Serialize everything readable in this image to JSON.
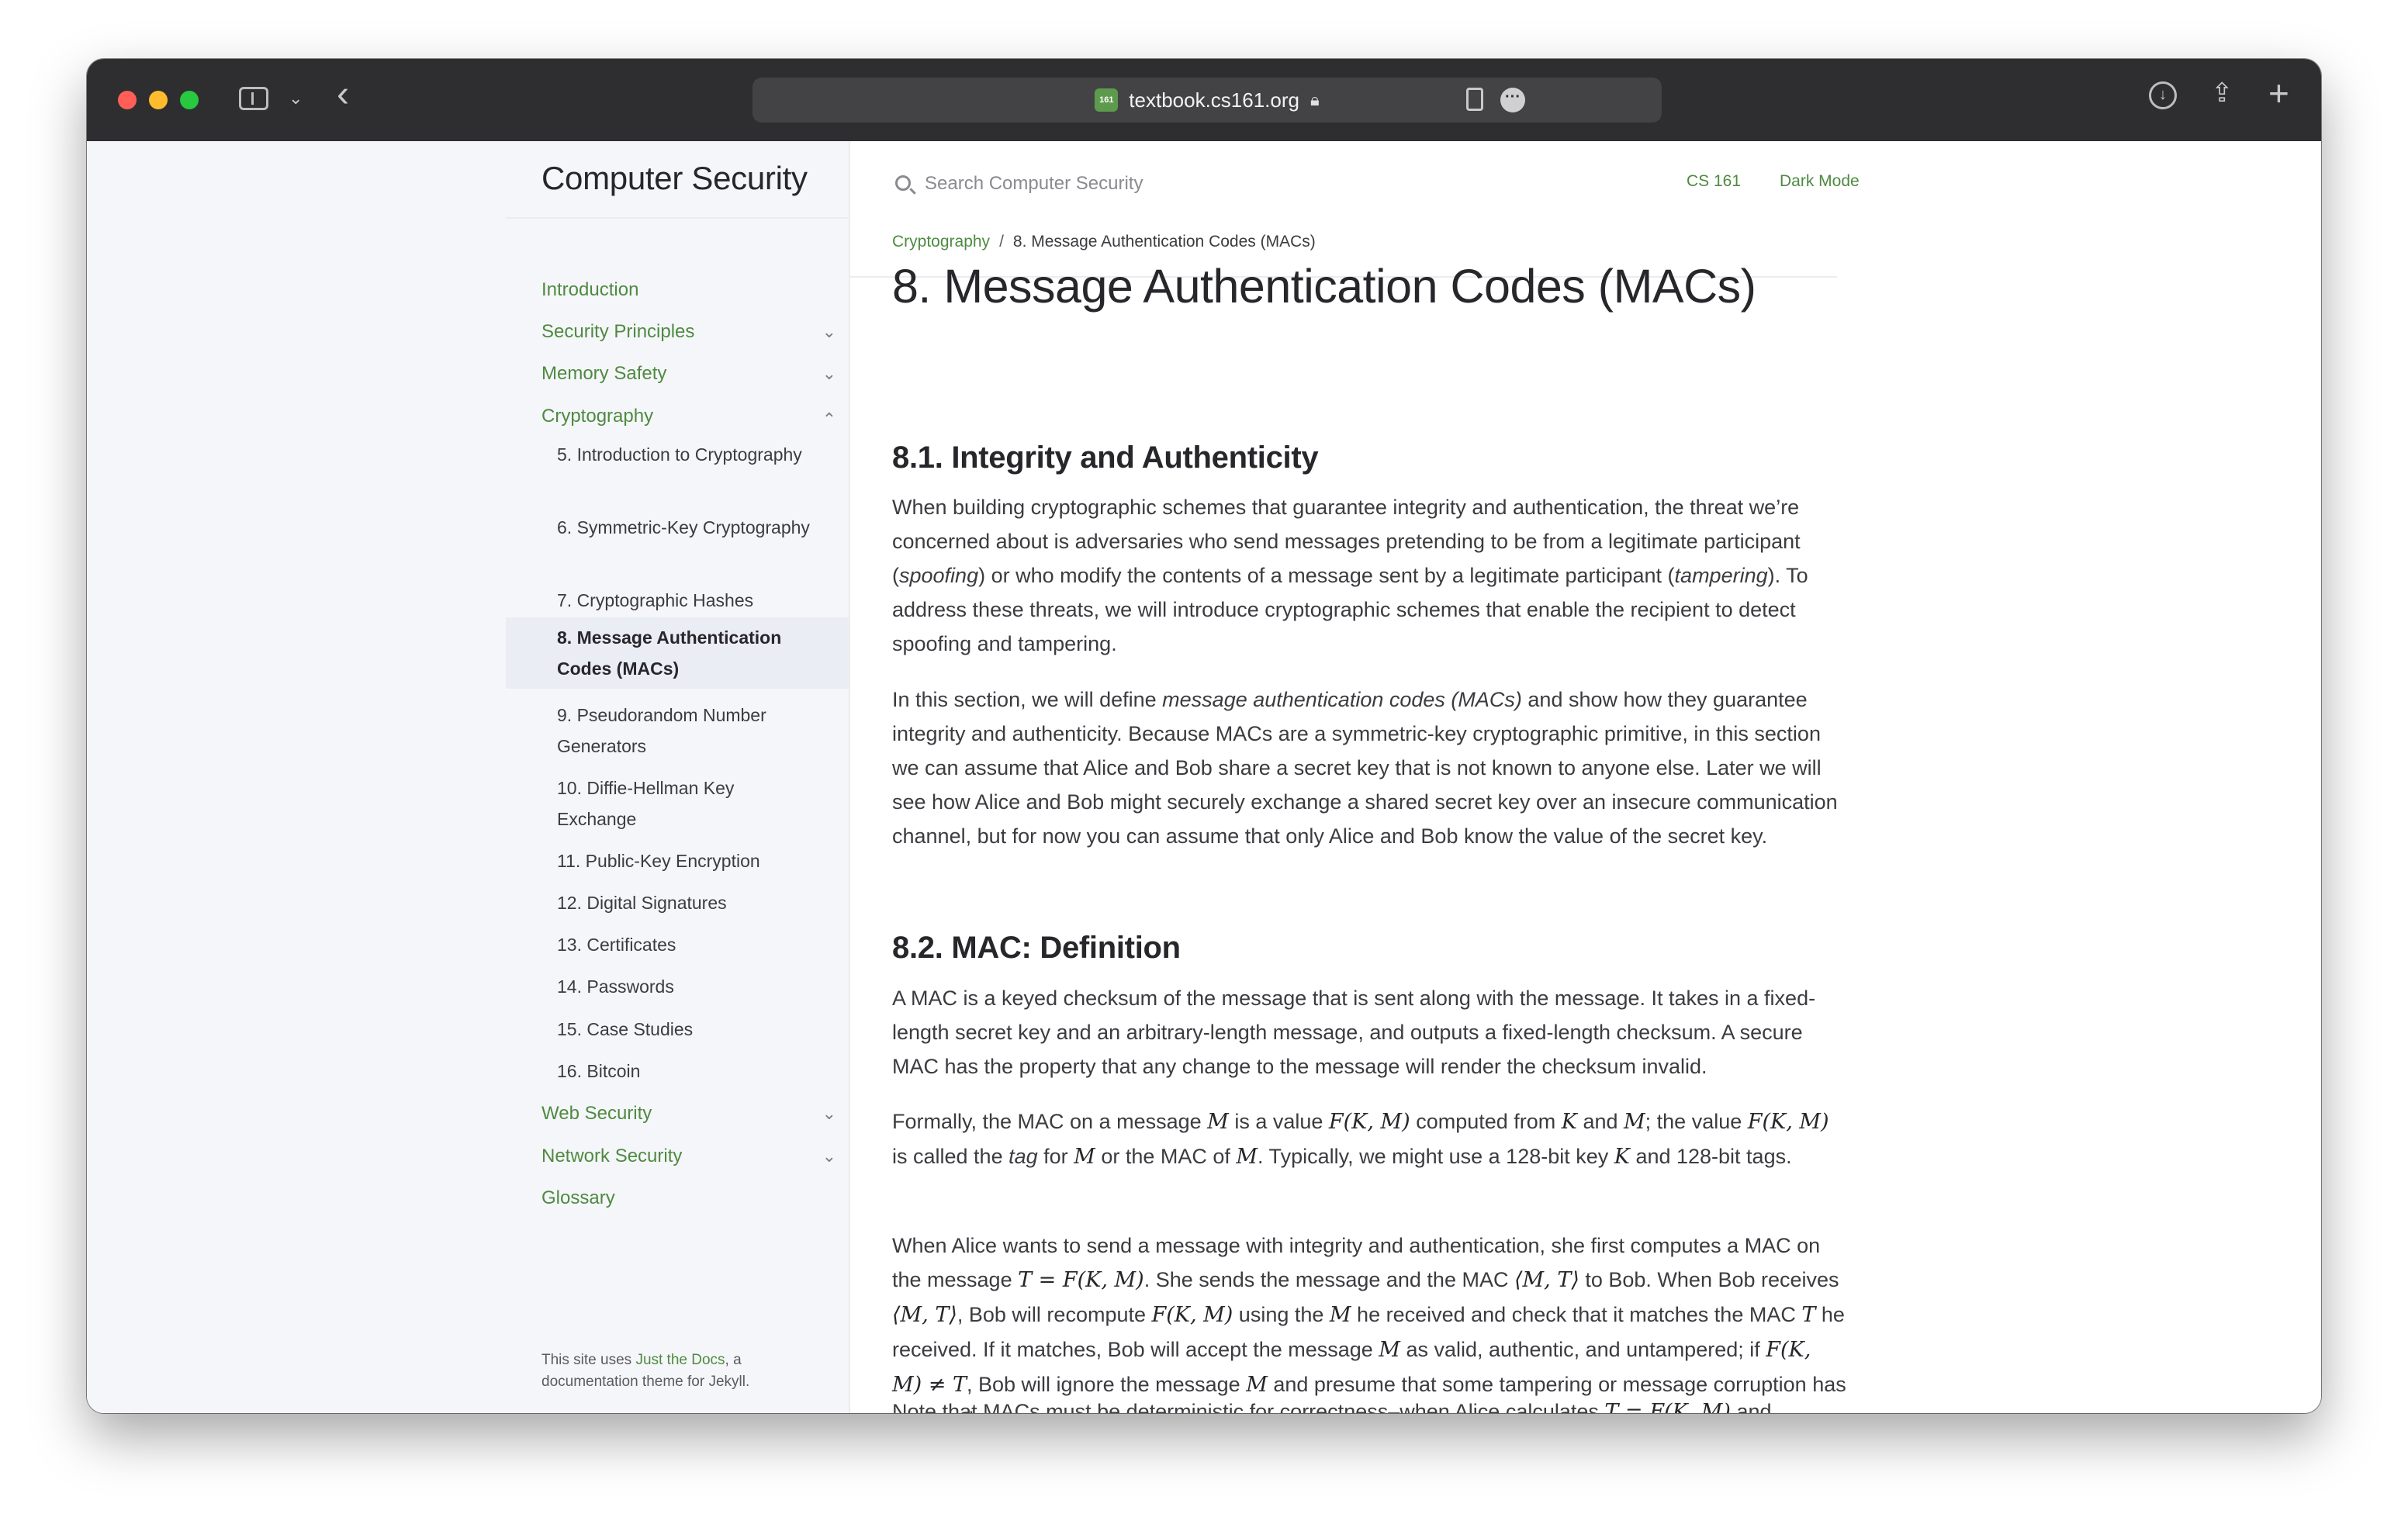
{
  "browser": {
    "url": "textbook.cs161.org",
    "site_badge": "161"
  },
  "site": {
    "title": "Computer Security",
    "search_placeholder": "Search Computer Security",
    "aux_links": [
      "CS 161",
      "Dark Mode"
    ]
  },
  "nav": {
    "top_items": [
      {
        "label": "Introduction",
        "expandable": false
      },
      {
        "label": "Security Principles",
        "expandable": true,
        "expanded": false
      },
      {
        "label": "Memory Safety",
        "expandable": true,
        "expanded": false
      },
      {
        "label": "Cryptography",
        "expandable": true,
        "expanded": true
      }
    ],
    "sub_items": [
      {
        "label": "5. Introduction to Cryptography"
      },
      {
        "label": "6. Symmetric-Key Cryptography"
      },
      {
        "label": "7. Cryptographic Hashes"
      },
      {
        "label": "8. Message Authentication Codes (MACs)",
        "active": true
      },
      {
        "label": "9. Pseudorandom Number Generators"
      },
      {
        "label": "10. Diffie-Hellman Key Exchange"
      },
      {
        "label": "11. Public-Key Encryption"
      },
      {
        "label": "12. Digital Signatures"
      },
      {
        "label": "13. Certificates"
      },
      {
        "label": "14. Passwords"
      },
      {
        "label": "15. Case Studies"
      },
      {
        "label": "16. Bitcoin"
      }
    ],
    "bottom_items": [
      {
        "label": "Web Security",
        "expandable": true,
        "expanded": false
      },
      {
        "label": "Network Security",
        "expandable": true,
        "expanded": false
      },
      {
        "label": "Glossary",
        "expandable": false
      }
    ],
    "footer": {
      "prefix": "This site uses ",
      "link": "Just the Docs",
      "suffix": ", a documentation theme for Jekyll."
    }
  },
  "breadcrumb": {
    "parent": "Cryptography",
    "separator": "/",
    "current": "8. Message Authentication Codes (MACs)"
  },
  "content": {
    "title": "8. Message Authentication Codes (MACs)",
    "s1": {
      "heading": "8.1. Integrity and Authenticity",
      "p1": {
        "a": "When building cryptographic schemes that guarantee integrity and authentication, the threat we’re concerned about is adversaries who send messages pretending to be from a legitimate participant (",
        "b": "spoofing",
        "c": ") or who modify the contents of a message sent by a legitimate participant (",
        "d": "tampering",
        "e": "). To address these threats, we will introduce cryptographic schemes that enable the recipient to detect spoofing and tampering."
      },
      "p2": {
        "a": "In this section, we will define ",
        "b": "message authentication codes (MACs)",
        "c": " and show how they guarantee integrity and authenticity. Because MACs are a symmetric-key cryptographic primitive, in this section we can assume that Alice and Bob share a secret key that is not known to anyone else. Later we will see how Alice and Bob might securely exchange a shared secret key over an insecure communication channel, but for now you can assume that only Alice and Bob know the value of the secret key."
      }
    },
    "s2": {
      "heading": "8.2. MAC: Definition",
      "p1": "A MAC is a keyed checksum of the message that is sent along with the message. It takes in a fixed-length secret key and an arbitrary-length message, and outputs a fixed-length checksum. A secure MAC has the property that any change to the message will render the checksum invalid.",
      "p2": {
        "t1": "Formally, the MAC on a message ",
        "m1": "M",
        "t2": " is a value ",
        "m2": "F(K, M)",
        "t3": " computed from ",
        "m3": "K",
        "t4": " and ",
        "m4": "M",
        "t5": "; the value ",
        "m5": "F(K, M)",
        "t6": " is called the ",
        "t7": "tag",
        "t8": " for ",
        "m6": "M",
        "t9": " or the MAC of ",
        "m7": "M",
        "t10": ". Typically, we might use a 128-bit key ",
        "m8": "K",
        "t11": " and 128-bit tags."
      },
      "p3": {
        "t1": "When Alice wants to send a message with integrity and authentication, she first computes a MAC on the message ",
        "m1": "T = F(K, M)",
        "t2": ". She sends the message and the MAC ",
        "m2": "⟨M, T⟩",
        "t3": " to Bob. When Bob receives ",
        "m3": "⟨M, T⟩",
        "t4": ", Bob will recompute ",
        "m4": "F(K, M)",
        "t5": " using the ",
        "m5": "M",
        "t6": " he received and check that it matches the MAC ",
        "m6": "T",
        "t7": " he received. If it matches, Bob will accept the message ",
        "m7": "M",
        "t8": " as valid, authentic, and untampered; if ",
        "m8": "F(K, M) ≠ T",
        "t9": ", Bob will ignore the message ",
        "m9": "M",
        "t10": " and presume that some tampering or message corruption has occurred."
      },
      "p4": {
        "t1": "Note that MACs must be deterministic for correctness–when Alice calculates ",
        "m1": "T = F(K, M)",
        "t2": " and"
      }
    }
  }
}
